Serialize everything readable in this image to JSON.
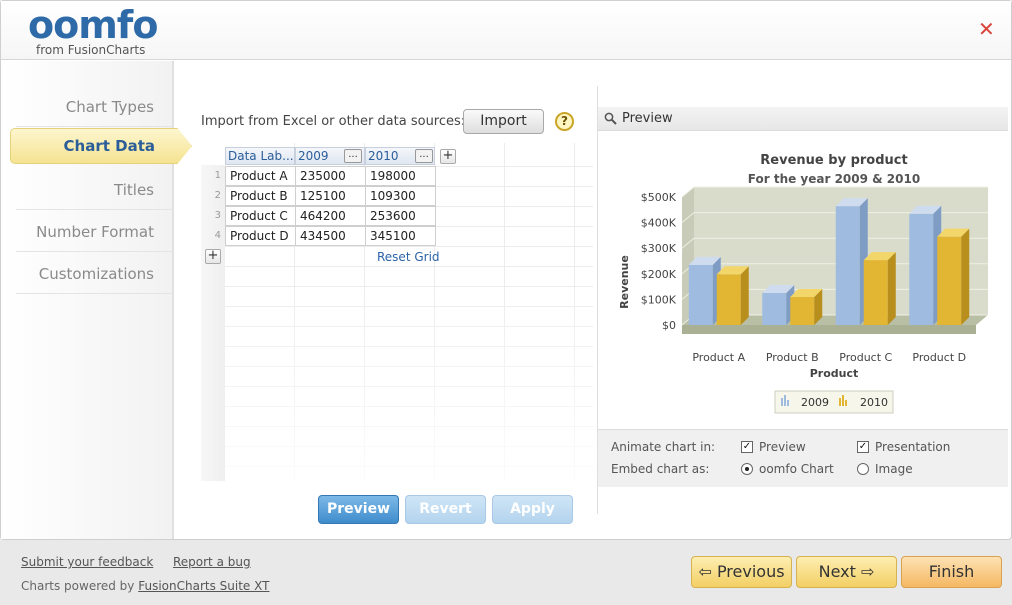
{
  "header": {
    "logo_text": "oomfo",
    "logo_sub": "from FusionCharts"
  },
  "sidebar": {
    "items": [
      {
        "label": "Chart Types"
      },
      {
        "label": "Chart Data"
      },
      {
        "label": "Titles"
      },
      {
        "label": "Number Format"
      },
      {
        "label": "Customizations"
      }
    ],
    "active": "Chart Data"
  },
  "import": {
    "label": "Import from Excel or other data sources:",
    "button": "Import",
    "help": "?"
  },
  "grid": {
    "headers": [
      "Data Lab...",
      "2009",
      "2010"
    ],
    "dots": "...",
    "plus": "+",
    "rows": [
      [
        "Product A",
        "235000",
        "198000"
      ],
      [
        "Product B",
        "125100",
        "109300"
      ],
      [
        "Product C",
        "464200",
        "253600"
      ],
      [
        "Product D",
        "434500",
        "345100"
      ]
    ],
    "row_numbers": [
      "1",
      "2",
      "3",
      "4"
    ],
    "reset": "Reset Grid"
  },
  "buttons": {
    "preview": "Preview",
    "revert": "Revert",
    "apply": "Apply"
  },
  "preview": {
    "title": "Preview"
  },
  "chart_data": {
    "type": "bar",
    "title": "Revenue by product",
    "subtitle": "For the year 2009 & 2010",
    "xlabel": "Product",
    "ylabel": "Revenue",
    "categories": [
      "Product A",
      "Product B",
      "Product C",
      "Product D"
    ],
    "series": [
      {
        "name": "2009",
        "values": [
          235000,
          125100,
          464200,
          434500
        ],
        "color": "#9fbbe0"
      },
      {
        "name": "2010",
        "values": [
          198000,
          109300,
          253600,
          345100
        ],
        "color": "#e2b632"
      }
    ],
    "y_ticks": [
      "$0",
      "$100K",
      "$200K",
      "$300K",
      "$400K",
      "$500K"
    ],
    "ylim": [
      0,
      500000
    ],
    "legend": "bottom"
  },
  "options": {
    "animate_label": "Animate chart in:",
    "animate_preview": "Preview",
    "animate_presentation": "Presentation",
    "embed_label": "Embed chart as:",
    "embed_oomfo": "oomfo Chart",
    "embed_image": "Image"
  },
  "footer": {
    "feedback": "Submit your feedback",
    "bug": "Report a bug",
    "powered_prefix": "Charts powered by ",
    "powered_link": "FusionCharts Suite XT"
  },
  "nav": {
    "previous": "Previous",
    "next": "Next",
    "finish": "Finish",
    "prev_arrow": "⇦",
    "next_arrow": "⇨"
  },
  "close": "✕"
}
